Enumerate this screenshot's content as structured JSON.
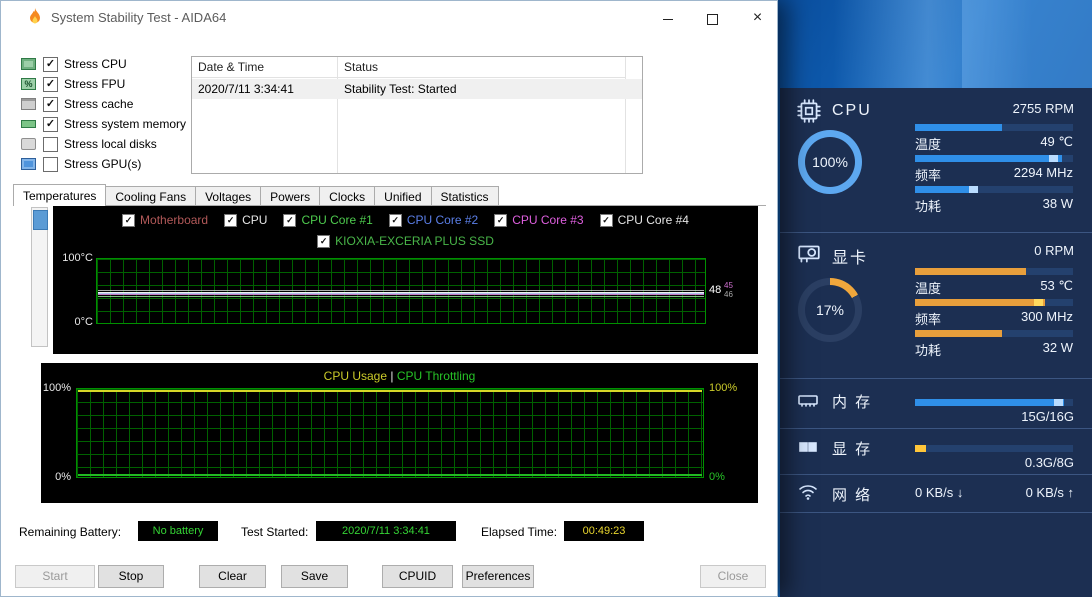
{
  "glyphs": {
    "check": "✓",
    "close": "×",
    "percent": "%"
  },
  "window": {
    "title": "System Stability Test - AIDA64"
  },
  "stress_options": [
    {
      "label": "Stress CPU",
      "checked": true
    },
    {
      "label": "Stress FPU",
      "checked": true
    },
    {
      "label": "Stress cache",
      "checked": true
    },
    {
      "label": "Stress system memory",
      "checked": true
    },
    {
      "label": "Stress local disks",
      "checked": false
    },
    {
      "label": "Stress GPU(s)",
      "checked": false
    }
  ],
  "log_table": {
    "columns": [
      "Date & Time",
      "Status"
    ],
    "rows": [
      {
        "datetime": "2020/7/11 3:34:41",
        "status": "Stability Test: Started"
      }
    ]
  },
  "tabs": {
    "items": [
      "Temperatures",
      "Cooling Fans",
      "Voltages",
      "Powers",
      "Clocks",
      "Unified",
      "Statistics"
    ],
    "active": "Temperatures"
  },
  "temperature_chart": {
    "legend": [
      {
        "label": "Motherboard",
        "color": "#b25959"
      },
      {
        "label": "CPU",
        "color": "#e6e6e6"
      },
      {
        "label": "CPU Core #1",
        "color": "#4ecb4e"
      },
      {
        "label": "CPU Core #2",
        "color": "#5b7fe8"
      },
      {
        "label": "CPU Core #3",
        "color": "#df5fdf"
      },
      {
        "label": "CPU Core #4",
        "color": "#e6e6e6"
      },
      {
        "label": "KIOXIA-EXCERIA PLUS SSD",
        "color": "#49b649"
      }
    ],
    "y_max": "100°C",
    "y_min": "0°C",
    "current_value": "48",
    "secondary_values": [
      "45",
      "46"
    ]
  },
  "usage_chart": {
    "title_left": "CPU Usage",
    "title_sep": "|",
    "title_right": "CPU Throttling",
    "y_max_left": "100%",
    "y_min_left": "0%",
    "y_max_right": "100%",
    "y_min_right": "0%"
  },
  "chart_data": [
    {
      "type": "line",
      "title": "Temperatures",
      "ylabel": "°C",
      "ylim": [
        0,
        100
      ],
      "series": [
        {
          "name": "Motherboard",
          "values": [
            48,
            48,
            48,
            48,
            48,
            48,
            48,
            48
          ]
        },
        {
          "name": "CPU",
          "values": [
            46,
            46,
            45,
            46,
            46,
            45,
            46,
            46
          ]
        },
        {
          "name": "CPU Core #1",
          "values": [
            45,
            46,
            45,
            46,
            45,
            46,
            45,
            46
          ]
        },
        {
          "name": "CPU Core #2",
          "values": [
            46,
            45,
            46,
            45,
            46,
            45,
            46,
            45
          ]
        },
        {
          "name": "CPU Core #3",
          "values": [
            45,
            46,
            46,
            45,
            46,
            46,
            45,
            46
          ]
        },
        {
          "name": "CPU Core #4",
          "values": [
            46,
            45,
            45,
            46,
            45,
            45,
            46,
            45
          ]
        },
        {
          "name": "KIOXIA-EXCERIA PLUS SSD",
          "values": [
            48,
            48,
            48,
            48,
            48,
            48,
            48,
            48
          ]
        }
      ],
      "note": "flat traces around 45-48°C for the whole test"
    },
    {
      "type": "line",
      "title": "CPU Usage | CPU Throttling",
      "ylim": [
        0,
        100
      ],
      "series": [
        {
          "name": "CPU Usage",
          "values": [
            100,
            100,
            100,
            100,
            100,
            100,
            100,
            100
          ]
        },
        {
          "name": "CPU Throttling",
          "values": [
            0,
            0,
            0,
            0,
            0,
            0,
            0,
            0
          ]
        }
      ]
    }
  ],
  "status_bar": {
    "battery_label": "Remaining Battery:",
    "battery_value": "No battery",
    "started_label": "Test Started:",
    "started_value": "2020/7/11 3:34:41",
    "elapsed_label": "Elapsed Time:",
    "elapsed_value": "00:49:23"
  },
  "action_buttons": [
    {
      "label": "Start",
      "enabled": false
    },
    {
      "label": "Stop",
      "enabled": true
    },
    {
      "label": "Clear",
      "enabled": true
    },
    {
      "label": "Save",
      "enabled": true
    },
    {
      "label": "CPUID",
      "enabled": true
    },
    {
      "label": "Preferences",
      "enabled": true
    },
    {
      "label": "Close",
      "enabled": false
    }
  ],
  "sensor_panel": {
    "cpu": {
      "name": "CPU",
      "fan": "2755 RPM",
      "usage": "100%",
      "usage_pct": 100,
      "accent": "#2f8fe8",
      "gauge_color": "#5da8f0",
      "rows": [
        {
          "label": "温度",
          "value": "49 ℃",
          "bar_pct": 55
        },
        {
          "label": "频率",
          "value": "2294 MHz",
          "bar_pct": 93
        },
        {
          "label": "功耗",
          "value": "38 W",
          "bar_pct": 36
        }
      ]
    },
    "gpu": {
      "name": "显卡",
      "fan": "0 RPM",
      "usage": "17%",
      "usage_pct": 17,
      "accent": "#e89f3c",
      "gauge_color": "#f0a73c",
      "rows": [
        {
          "label": "温度",
          "value": "53 ℃",
          "bar_pct": 70
        },
        {
          "label": "频率",
          "value": "300 MHz",
          "bar_pct": 82
        },
        {
          "label": "功耗",
          "value": "32 W",
          "bar_pct": 55
        }
      ]
    },
    "memory": {
      "name": "内 存",
      "value": "15G/16G",
      "bar_pct": 94,
      "accent": "#2f8fe8"
    },
    "vram": {
      "name": "显 存",
      "value": "0.3G/8G",
      "bar_pct": 7,
      "accent": "#ffc63a"
    },
    "network": {
      "name": "网 络",
      "down": "0 KB/s ↓",
      "up": "0 KB/s ↑"
    }
  }
}
